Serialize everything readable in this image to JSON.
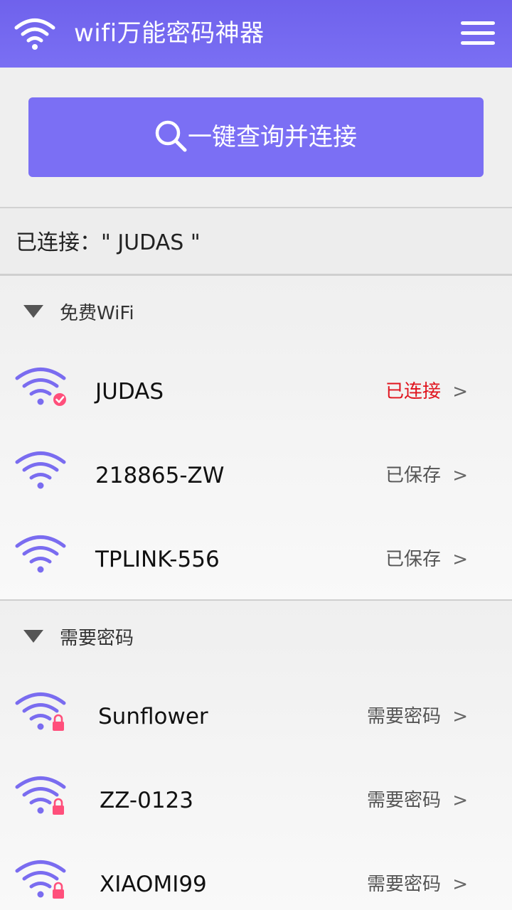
{
  "header": {
    "title": "wifi万能密码神器",
    "logo_icon": "wifi-icon",
    "menu_icon": "menu-icon"
  },
  "scan_button": {
    "label": "一键查询并连接",
    "icon": "search-icon"
  },
  "connected": {
    "text": "已连接：\"  JUDAS  \""
  },
  "sections": [
    {
      "title": "免费WiFi",
      "networks": [
        {
          "name": "JUDAS",
          "status": "已连接",
          "badge": "check"
        },
        {
          "name": "218865-ZW",
          "status": "已保存",
          "badge": "none"
        },
        {
          "name": "TPLINK-556",
          "status": "已保存",
          "badge": "none"
        }
      ]
    },
    {
      "title": "需要密码",
      "networks": [
        {
          "name": "Sunflower",
          "status": "需要密码",
          "badge": "lock"
        },
        {
          "name": "ZZ-0123",
          "status": "需要密码",
          "badge": "lock"
        },
        {
          "name": "XIAOMI99",
          "status": "需要密码",
          "badge": "lock"
        }
      ]
    }
  ],
  "chevron": ">",
  "colors": {
    "accent": "#7b6ff4",
    "wifi_icon": "#7a6cf0",
    "badge": "#ff4f7b",
    "connected_status": "#e0141e"
  }
}
